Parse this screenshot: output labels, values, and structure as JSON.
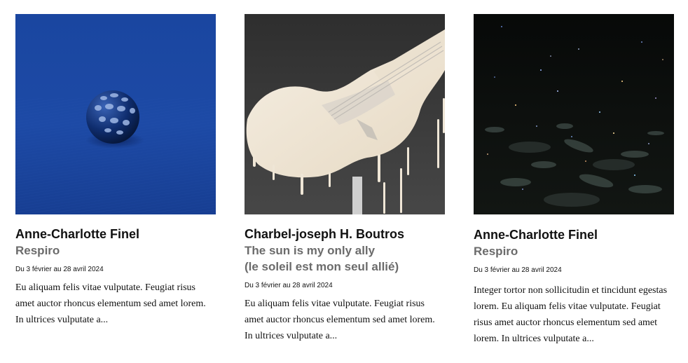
{
  "cards": [
    {
      "artist": "Anne-Charlotte Finel",
      "title_lines": [
        "Respiro"
      ],
      "dates": "Du 3 février au 28 avril 2024",
      "excerpt": "Eu aliquam felis vitae vulputate. Feugiat risus amet auctor rhoncus elementum sed amet lorem. In ultrices vulputate a...",
      "image": "blue-sphere-on-blue-fabric",
      "colors": {
        "bg": "#1c4aa3",
        "sphere": "#0f2d6e"
      }
    },
    {
      "artist": "Charbel-joseph H. Boutros",
      "title_lines": [
        "The sun is my only ally",
        "(le soleil est mon seul allié)"
      ],
      "dates": "Du 3 février au 28 avril 2024",
      "excerpt": "Eu aliquam felis vitae vulputate. Feugiat risus amet auctor rhoncus elementum sed amet lorem. In ultrices vulputate a...",
      "image": "melting-wax-guitar",
      "colors": {
        "bg": "#3a3a3a",
        "wax": "#efe6d6"
      }
    },
    {
      "artist": "Anne-Charlotte Finel",
      "title_lines": [
        "Respiro"
      ],
      "dates": "Du 3 février au 28 avril 2024",
      "excerpt": "Integer tortor non sollicitudin et tincidunt egestas lorem. Eu aliquam felis vitae vulputate. Feugiat risus amet auctor rhoncus elementum sed amet lorem. In ultrices vulputate a...",
      "image": "night-sea-with-specks",
      "colors": {
        "bg": "#0b0d0c"
      }
    }
  ]
}
